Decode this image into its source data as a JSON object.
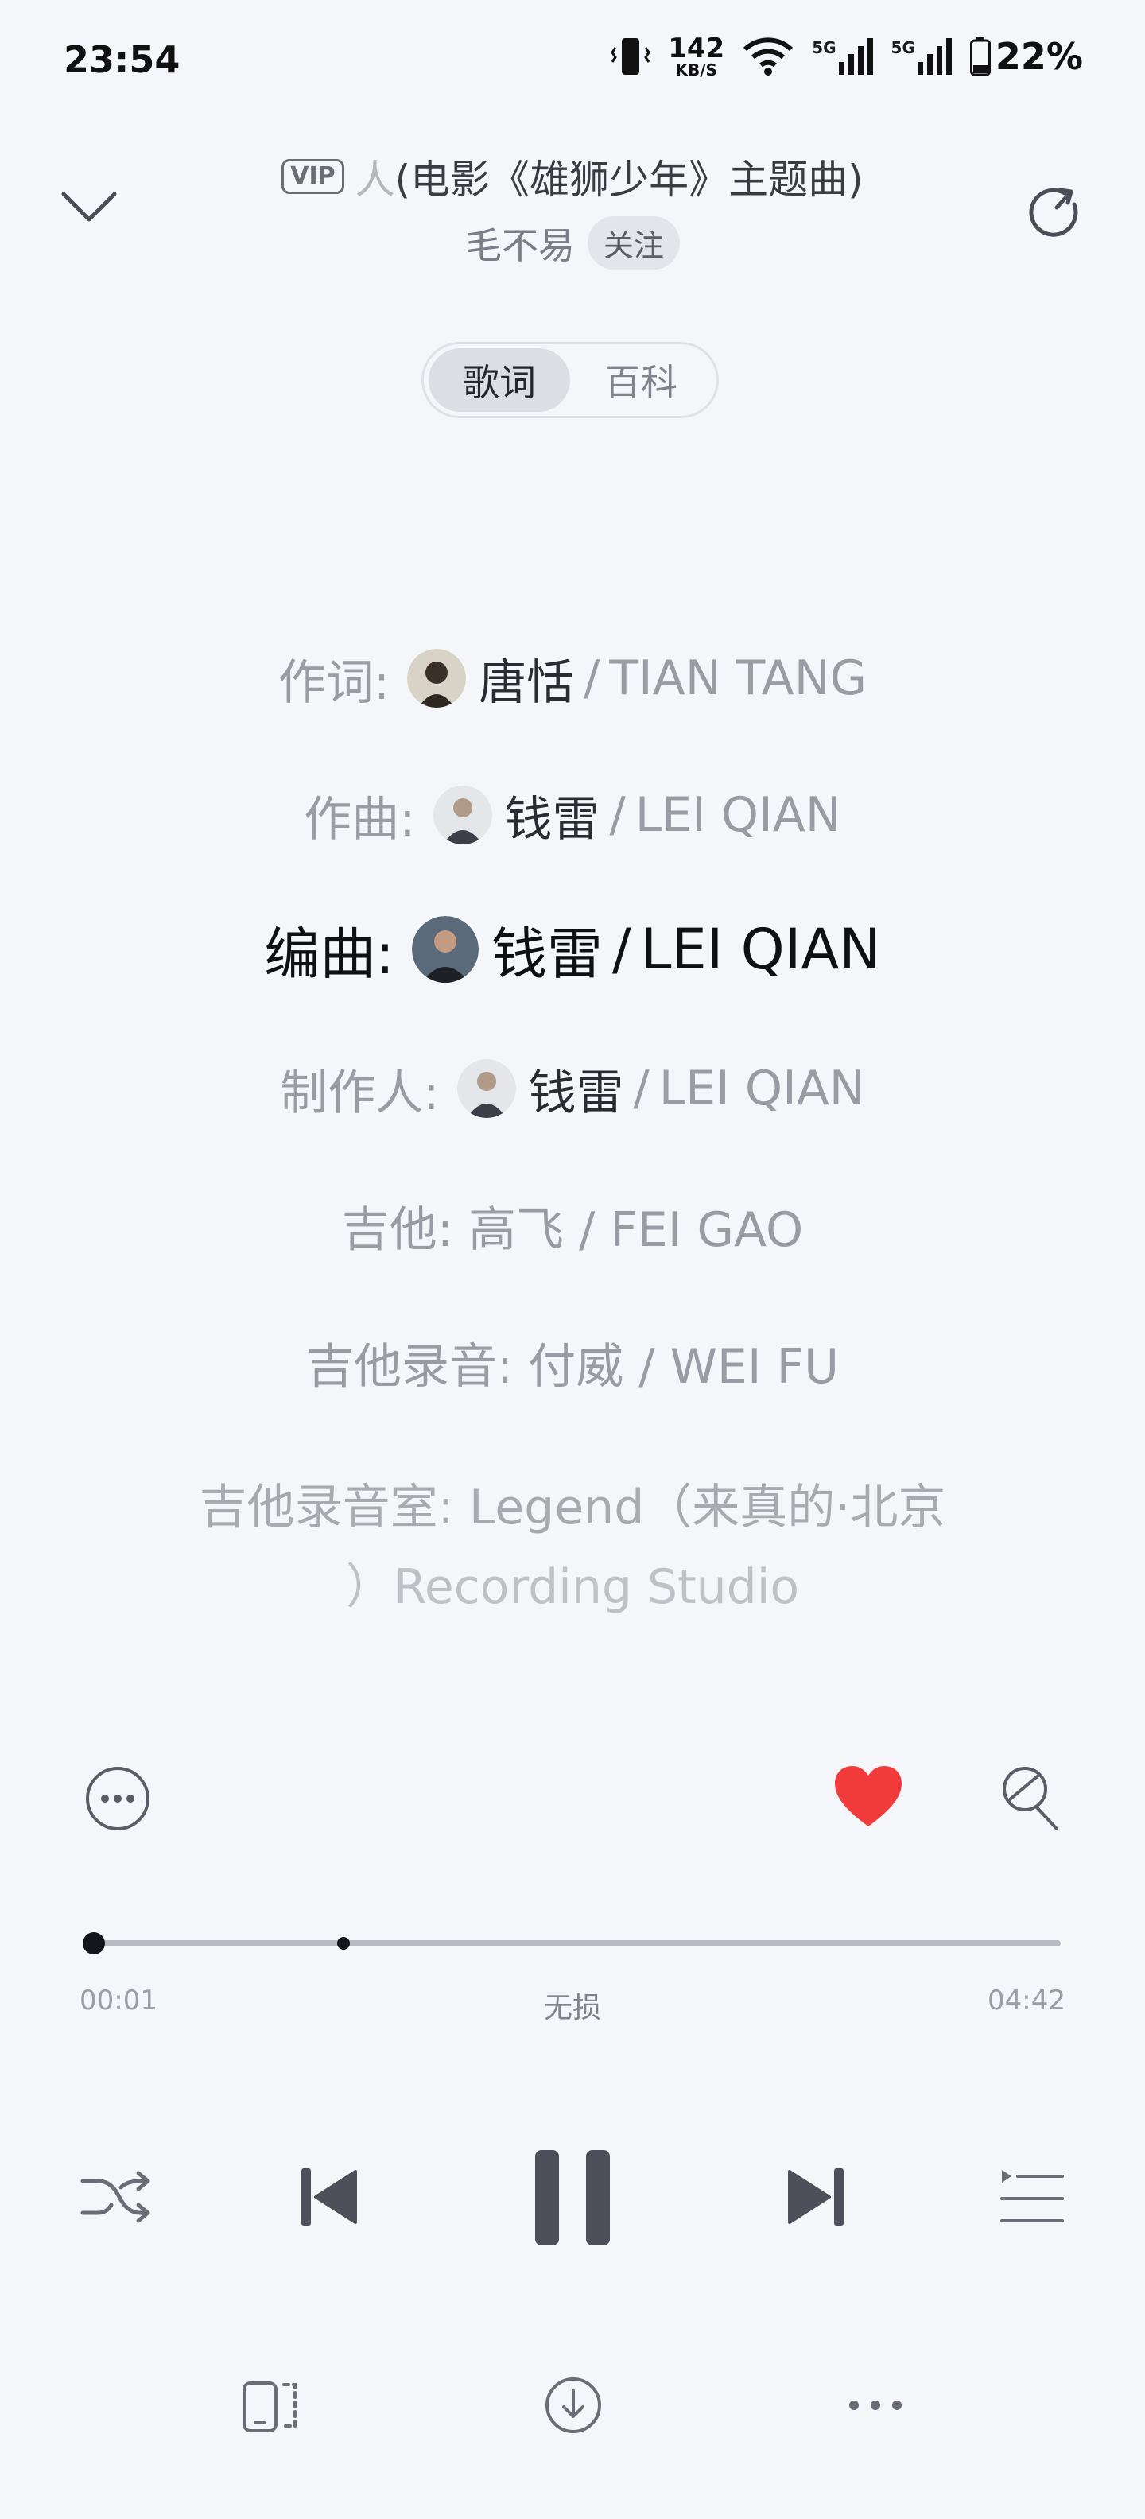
{
  "status_bar": {
    "time": "23:54",
    "net_speed_value": "142",
    "net_speed_unit": "KB/S",
    "signal_1": "5G",
    "signal_2": "5G",
    "battery": "22%"
  },
  "header": {
    "vip_badge": "VIP",
    "title_faded": "人",
    "title_main": "(电影《雄狮少年》主题曲)",
    "artist": "毛不易",
    "follow_label": "关注"
  },
  "tabs": [
    {
      "label": "歌词",
      "active": true
    },
    {
      "label": "百科",
      "active": false
    }
  ],
  "credits": [
    {
      "label": "作词:",
      "name": "唐恬",
      "separator": "/",
      "en": "TIAN TANG"
    },
    {
      "label": "作曲:",
      "name": "钱雷",
      "separator": "/",
      "en": "LEI QIAN"
    },
    {
      "label": "编曲:",
      "name": "钱雷",
      "separator": "/",
      "en": "LEI QIAN"
    },
    {
      "label": "制作人:",
      "name": "钱雷",
      "separator": "/",
      "en": "LEI QIAN"
    },
    {
      "text": "吉他: 高飞 / FEI GAO"
    },
    {
      "text": "吉他录音: 付威 / WEI FU"
    },
    {
      "line1": "吉他录音室: Legend（来真的·北京",
      "line2": "）Recording Studio"
    }
  ],
  "player": {
    "elapsed": "00:01",
    "quality": "无损",
    "duration": "04:42",
    "progress": 0.004,
    "liked": true,
    "accent_color": "#f23b3b"
  },
  "icons": {
    "collapse": "chevron-down-icon",
    "share": "share-icon",
    "more": "more-circle-icon",
    "like": "heart-icon",
    "karaoke": "microphone-icon",
    "shuffle": "shuffle-icon",
    "previous": "previous-icon",
    "pause": "pause-icon",
    "next": "next-icon",
    "playlist": "playlist-icon",
    "device": "device-icon",
    "download": "download-icon",
    "menu": "more-dots-icon"
  }
}
